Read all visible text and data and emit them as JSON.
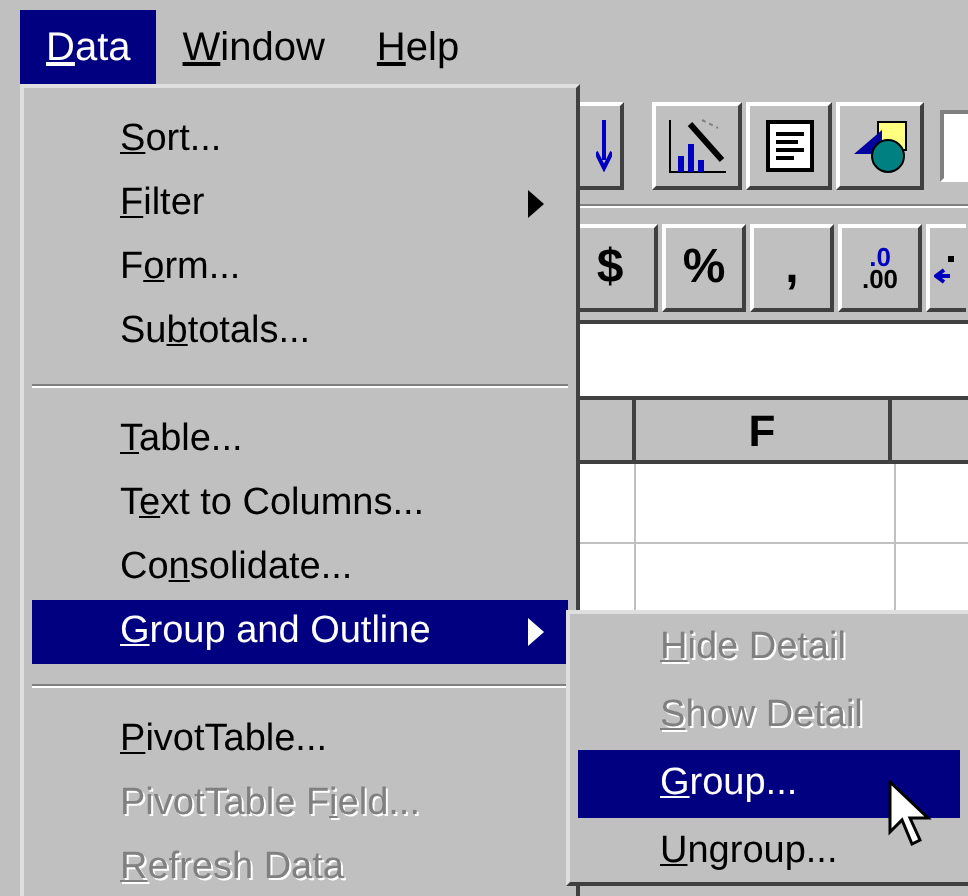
{
  "menu_bar": [
    {
      "key": "D",
      "after": "ata",
      "selected": true
    },
    {
      "key": "W",
      "after": "indow",
      "selected": false
    },
    {
      "key": "H",
      "after": "elp",
      "selected": false
    }
  ],
  "data_menu": [
    {
      "kind": "item",
      "key": "S",
      "after": "ort...",
      "disabled": false,
      "selected": false,
      "has_submenu": false
    },
    {
      "kind": "item",
      "key": "F",
      "after": "ilter",
      "disabled": false,
      "selected": false,
      "has_submenu": true
    },
    {
      "kind": "item",
      "before": "F",
      "key": "o",
      "after": "rm...",
      "disabled": false,
      "selected": false,
      "has_submenu": false
    },
    {
      "kind": "item",
      "before": "Su",
      "key": "b",
      "after": "totals...",
      "disabled": false,
      "selected": false,
      "has_submenu": false
    },
    {
      "kind": "separator"
    },
    {
      "kind": "item",
      "key": "T",
      "after": "able...",
      "disabled": false,
      "selected": false,
      "has_submenu": false
    },
    {
      "kind": "item",
      "before": "T",
      "key": "e",
      "after": "xt to Columns...",
      "disabled": false,
      "selected": false,
      "has_submenu": false
    },
    {
      "kind": "item",
      "before": "Co",
      "key": "n",
      "after": "solidate...",
      "disabled": false,
      "selected": false,
      "has_submenu": false
    },
    {
      "kind": "item",
      "key": "G",
      "after": "roup and Outline",
      "disabled": false,
      "selected": true,
      "has_submenu": true
    },
    {
      "kind": "separator"
    },
    {
      "kind": "item",
      "key": "P",
      "after": "ivotTable...",
      "disabled": false,
      "selected": false,
      "has_submenu": false
    },
    {
      "kind": "item",
      "before": "PivotTable F",
      "key": "i",
      "after": "eld...",
      "disabled": true,
      "selected": false,
      "has_submenu": false
    },
    {
      "kind": "item",
      "key": "R",
      "after": "efresh Data",
      "disabled": true,
      "selected": false,
      "has_submenu": false
    }
  ],
  "group_submenu": [
    {
      "key": "H",
      "after": "ide Detail",
      "disabled": true,
      "selected": false
    },
    {
      "key": "S",
      "after": "how Detail",
      "disabled": true,
      "selected": false
    },
    {
      "key": "G",
      "after": "roup...",
      "disabled": false,
      "selected": true
    },
    {
      "key": "U",
      "after": "ngroup...",
      "disabled": false,
      "selected": false
    }
  ],
  "toolbar_1": [
    {
      "kind": "sort"
    },
    {
      "kind": "chart"
    },
    {
      "kind": "text"
    },
    {
      "kind": "drawing"
    },
    {
      "kind": "field"
    }
  ],
  "toolbar_2": [
    {
      "kind": "label",
      "label": "$"
    },
    {
      "kind": "label",
      "label": "%"
    },
    {
      "kind": "label",
      "label": ","
    },
    {
      "kind": "decimal",
      "top": ".0",
      "bottom": ".00"
    },
    {
      "kind": "arrow"
    }
  ],
  "column_headers": [
    "F"
  ]
}
